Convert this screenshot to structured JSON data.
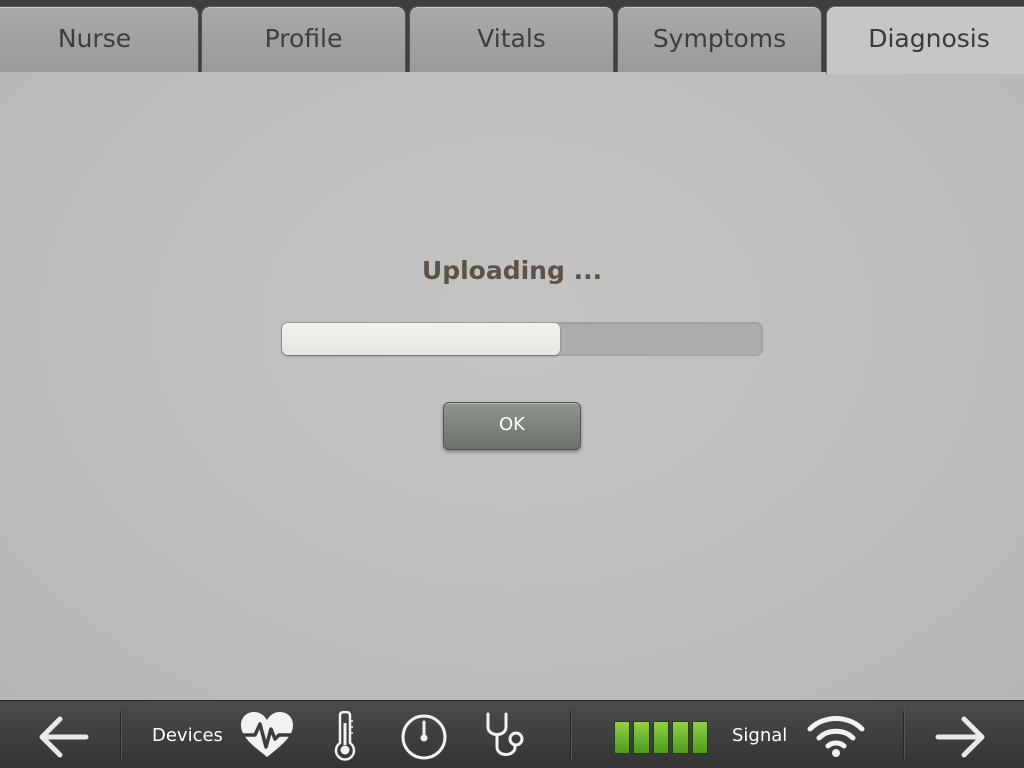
{
  "tabs": [
    {
      "label": "Nurse",
      "active": false
    },
    {
      "label": "Profile",
      "active": false
    },
    {
      "label": "Vitals",
      "active": false
    },
    {
      "label": "Symptoms",
      "active": false
    },
    {
      "label": "Diagnosis",
      "active": true
    }
  ],
  "upload": {
    "status_text": "Uploading ...",
    "progress_percent": 58,
    "ok_label": "OK"
  },
  "bottom_bar": {
    "back_icon": "arrow-left-icon",
    "devices_label": "Devices",
    "device_icons": [
      "heart-rate-icon",
      "thermometer-icon",
      "gauge-icon",
      "stethoscope-icon"
    ],
    "battery_cells": 5,
    "battery_color": "#6bb82c",
    "signal_label": "Signal",
    "signal_icon": "wifi-icon",
    "forward_icon": "arrow-right-icon"
  },
  "colors": {
    "title_text": "#5e5248",
    "button_bg": "#7d837d",
    "background": "#bdbdbb"
  }
}
